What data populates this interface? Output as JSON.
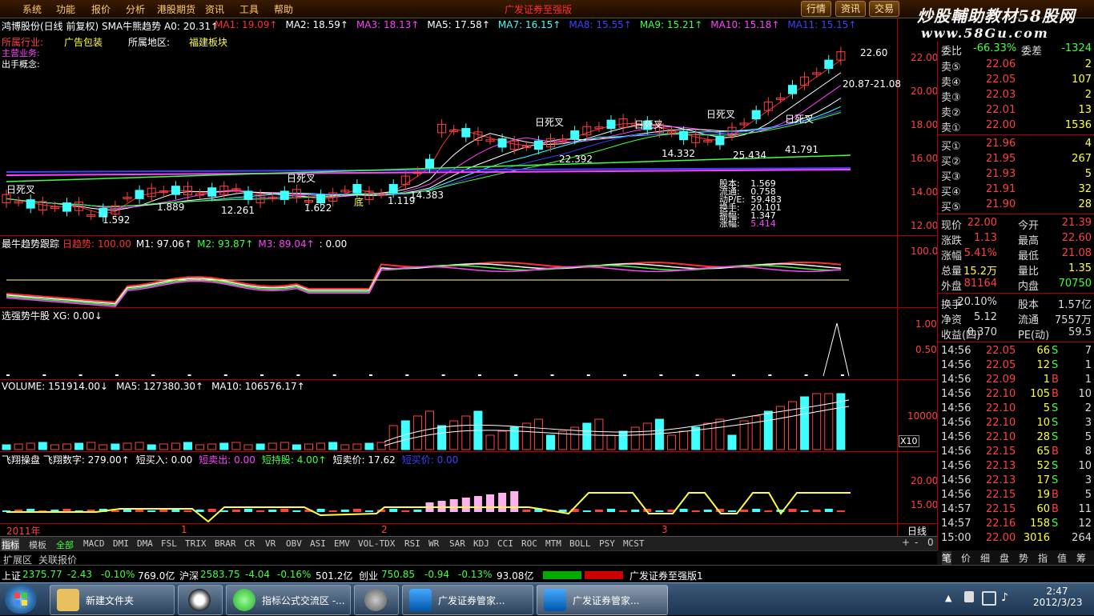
{
  "menu": {
    "items": [
      "系统",
      "功能",
      "报价",
      "分析",
      "港股期货",
      "资讯",
      "工具",
      "帮助"
    ],
    "title_center": "广发证券至强版",
    "right_buttons": [
      "行情",
      "资讯",
      "交易"
    ],
    "watermark": "炒股輔助教材58股网",
    "watermark_url": "www.58Gu.com"
  },
  "main": {
    "stock_line": "鸿博股份(日线 前复权) SMA牛熊趋势 A0: 20.31↑",
    "ma": [
      {
        "label": "MA1: 19.09↑",
        "color": "#ff3030"
      },
      {
        "label": "MA2: 18.59↑",
        "color": "#ffffff"
      },
      {
        "label": "MA3: 18.13↑",
        "color": "#ff40ff"
      },
      {
        "label": "MA5: 17.58↑",
        "color": "#ffffff"
      },
      {
        "label": "MA7: 16.15↑",
        "color": "#40ffff"
      },
      {
        "label": "MA8: 15.55↑",
        "color": "#4040ff"
      },
      {
        "label": "MA9: 15.21↑",
        "color": "#40ff40"
      },
      {
        "label": "MA10: 15.18↑",
        "color": "#ff40ff"
      },
      {
        "label": "MA11: 15.15↑",
        "color": "#4040ff"
      }
    ],
    "industry_label": "所属行业:",
    "industry_value": "广告包装",
    "region_label": "所属地区:",
    "region_value": "福建板块",
    "extra_labels": [
      "主营业务:",
      "出手概念:"
    ],
    "y_axis": [
      "22.00",
      "20.00",
      "18.00",
      "16.00",
      "14.00",
      "12.00"
    ],
    "annotations": [
      {
        "t": "22.60"
      },
      {
        "t": "20.87-21.08"
      },
      {
        "t": "日死叉"
      },
      {
        "t": "日死叉"
      },
      {
        "t": "日死叉"
      },
      {
        "t": "日死叉"
      },
      {
        "t": "日死叉"
      },
      {
        "t": "日死叉"
      },
      {
        "t": "22.392"
      },
      {
        "t": "14.332"
      },
      {
        "t": "25.434"
      },
      {
        "t": "41.791"
      },
      {
        "t": "14.383"
      },
      {
        "t": "1.622"
      },
      {
        "t": "12.261"
      },
      {
        "t": "1.889"
      },
      {
        "t": "1.592"
      },
      {
        "t": "底"
      },
      {
        "t": "1.119"
      }
    ],
    "stats": [
      {
        "k": "股本:",
        "v": "1.569"
      },
      {
        "k": "流通:",
        "v": "0.758"
      },
      {
        "k": "动P/E:",
        "v": "59.483"
      },
      {
        "k": "换手:",
        "v": "20.101"
      },
      {
        "k": "振幅:",
        "v": "1.347"
      },
      {
        "k": "涨幅:",
        "v": "5.414"
      }
    ]
  },
  "pane2": {
    "title": "最牛趋势跟踪",
    "items": [
      {
        "label": "日趋势: 100.00",
        "color": "#ff3030"
      },
      {
        "label": "M1: 97.06↑",
        "color": "#ffffff"
      },
      {
        "label": "M2: 93.87↑",
        "color": "#40ff40"
      },
      {
        "label": "M3: 89.04↑",
        "color": "#ff40ff"
      },
      {
        "label": ": 0.00",
        "color": "#ffffff"
      }
    ],
    "y_axis": [
      "100.0"
    ]
  },
  "pane3": {
    "title": "选强势牛股 XG: 0.00↓",
    "y_axis": [
      "1.00",
      "0.50"
    ]
  },
  "pane4": {
    "items": [
      {
        "label": "VOLUME: 151914.00↓",
        "color": "#ffffff"
      },
      {
        "label": "MA5: 127380.30↑",
        "color": "#ffffff"
      },
      {
        "label": "MA10: 106576.17↑",
        "color": "#ffffff"
      }
    ],
    "y_axis": [
      "10000"
    ],
    "unit": "X10"
  },
  "pane5": {
    "items": [
      {
        "label": "飞翔操盘 飞翔数字: 279.00↑",
        "color": "#ffffff"
      },
      {
        "label": "短买入: 0.00",
        "color": "#ffffff"
      },
      {
        "label": "短卖出: 0.00",
        "color": "#ff40ff"
      },
      {
        "label": "短持股: 4.00↑",
        "color": "#40ff40"
      },
      {
        "label": "短卖价: 17.62",
        "color": "#ffffff"
      },
      {
        "label": "短买价: 0.00",
        "color": "#4040ff"
      }
    ],
    "y_axis": [
      "20.00",
      "15.00"
    ]
  },
  "x_axis": {
    "labels": [
      "2011年",
      "1",
      "2",
      "3"
    ],
    "period": "日线"
  },
  "tabs": [
    "指标",
    "模板",
    "全部",
    "MACD",
    "DMI",
    "DMA",
    "FSL",
    "TRIX",
    "BRAR",
    "CR",
    "VR",
    "OBV",
    "ASI",
    "EMV",
    "VOL-TDX",
    "RSI",
    "WR",
    "SAR",
    "KDJ",
    "CCI",
    "ROC",
    "MTM",
    "BOLL",
    "PSY",
    "MCST"
  ],
  "ext_tabs": [
    "扩展区",
    "关联报价"
  ],
  "right_tabs": [
    "笔",
    "价",
    "细",
    "盘",
    "势",
    "指",
    "值",
    "筹"
  ],
  "quote": {
    "header": {
      "k": "委比",
      "v": "-66.33%",
      "k2": "委差",
      "v2": "-1324"
    },
    "sells": [
      {
        "k": "卖⑤",
        "p": "22.06",
        "v": "2"
      },
      {
        "k": "卖④",
        "p": "22.05",
        "v": "107"
      },
      {
        "k": "卖③",
        "p": "22.03",
        "v": "2"
      },
      {
        "k": "卖②",
        "p": "22.01",
        "v": "13"
      },
      {
        "k": "卖①",
        "p": "22.00",
        "v": "1536"
      }
    ],
    "buys": [
      {
        "k": "买①",
        "p": "21.96",
        "v": "4"
      },
      {
        "k": "买②",
        "p": "21.95",
        "v": "267"
      },
      {
        "k": "买③",
        "p": "21.93",
        "v": "5"
      },
      {
        "k": "买④",
        "p": "21.91",
        "v": "32"
      },
      {
        "k": "买⑤",
        "p": "21.90",
        "v": "28"
      }
    ],
    "info": [
      {
        "k": "现价",
        "v": "22.00",
        "k2": "今开",
        "v2": "21.39"
      },
      {
        "k": "涨跌",
        "v": "1.13",
        "k2": "最高",
        "v2": "22.60"
      },
      {
        "k": "涨幅",
        "v": "5.41%",
        "k2": "最低",
        "v2": "21.08"
      },
      {
        "k": "总量",
        "v": "15.2万",
        "k2": "量比",
        "v2": "1.35"
      },
      {
        "k": "外盘",
        "v": "81164",
        "k2": "内盘",
        "v2": "70750"
      }
    ],
    "fund": [
      {
        "k": "换手",
        "v": "20.10%",
        "k2": "股本",
        "v2": "1.57亿"
      },
      {
        "k": "净资",
        "v": "5.12",
        "k2": "流通",
        "v2": "7557万"
      },
      {
        "k": "收益(四)",
        "v": "0.370",
        "k2": "PE(动)",
        "v2": "59.5"
      }
    ],
    "ticks": [
      {
        "t": "14:56",
        "p": "22.05",
        "v": "66",
        "s": "S",
        "n": "7"
      },
      {
        "t": "14:56",
        "p": "22.05",
        "v": "12",
        "s": "S",
        "n": "1"
      },
      {
        "t": "14:56",
        "p": "22.09",
        "v": "1",
        "s": "B",
        "n": "1"
      },
      {
        "t": "14:56",
        "p": "22.10",
        "v": "105",
        "s": "B",
        "n": "10"
      },
      {
        "t": "14:56",
        "p": "22.10",
        "v": "5",
        "s": "S",
        "n": "2"
      },
      {
        "t": "14:56",
        "p": "22.10",
        "v": "10",
        "s": "S",
        "n": "3"
      },
      {
        "t": "14:56",
        "p": "22.10",
        "v": "28",
        "s": "S",
        "n": "5"
      },
      {
        "t": "14:56",
        "p": "22.15",
        "v": "65",
        "s": "B",
        "n": "8"
      },
      {
        "t": "14:56",
        "p": "22.13",
        "v": "52",
        "s": "S",
        "n": "10"
      },
      {
        "t": "14:56",
        "p": "22.13",
        "v": "17",
        "s": "S",
        "n": "3"
      },
      {
        "t": "14:56",
        "p": "22.15",
        "v": "19",
        "s": "B",
        "n": "5"
      },
      {
        "t": "14:57",
        "p": "22.15",
        "v": "60",
        "s": "B",
        "n": "11"
      },
      {
        "t": "14:57",
        "p": "22.16",
        "v": "158",
        "s": "S",
        "n": "12"
      },
      {
        "t": "15:00",
        "p": "22.00",
        "v": "3016",
        "s": "",
        "n": "264"
      }
    ]
  },
  "indexbar": {
    "sh_label": "上证",
    "sh": "2375.77",
    "sh_chg": "-2.43",
    "sh_pct": "-0.10%",
    "sh_amt": "769.0亿",
    "hs_label": "沪深",
    "hs": "2583.75",
    "hs_chg": "-4.04",
    "hs_pct": "-0.16%",
    "hs_amt": "501.2亿",
    "cy_label": "创业",
    "cy": "750.85",
    "cy_chg": "-0.94",
    "cy_pct": "-0.13%",
    "cy_amt": "93.08亿",
    "broker": "广发证券至强版1"
  },
  "taskbar": {
    "items": [
      "新建文件夹",
      "指标公式交流区 -...",
      "",
      "广发证券管家...",
      "广发证券管家..."
    ],
    "time": "2:47",
    "date": "2012/3/23"
  }
}
